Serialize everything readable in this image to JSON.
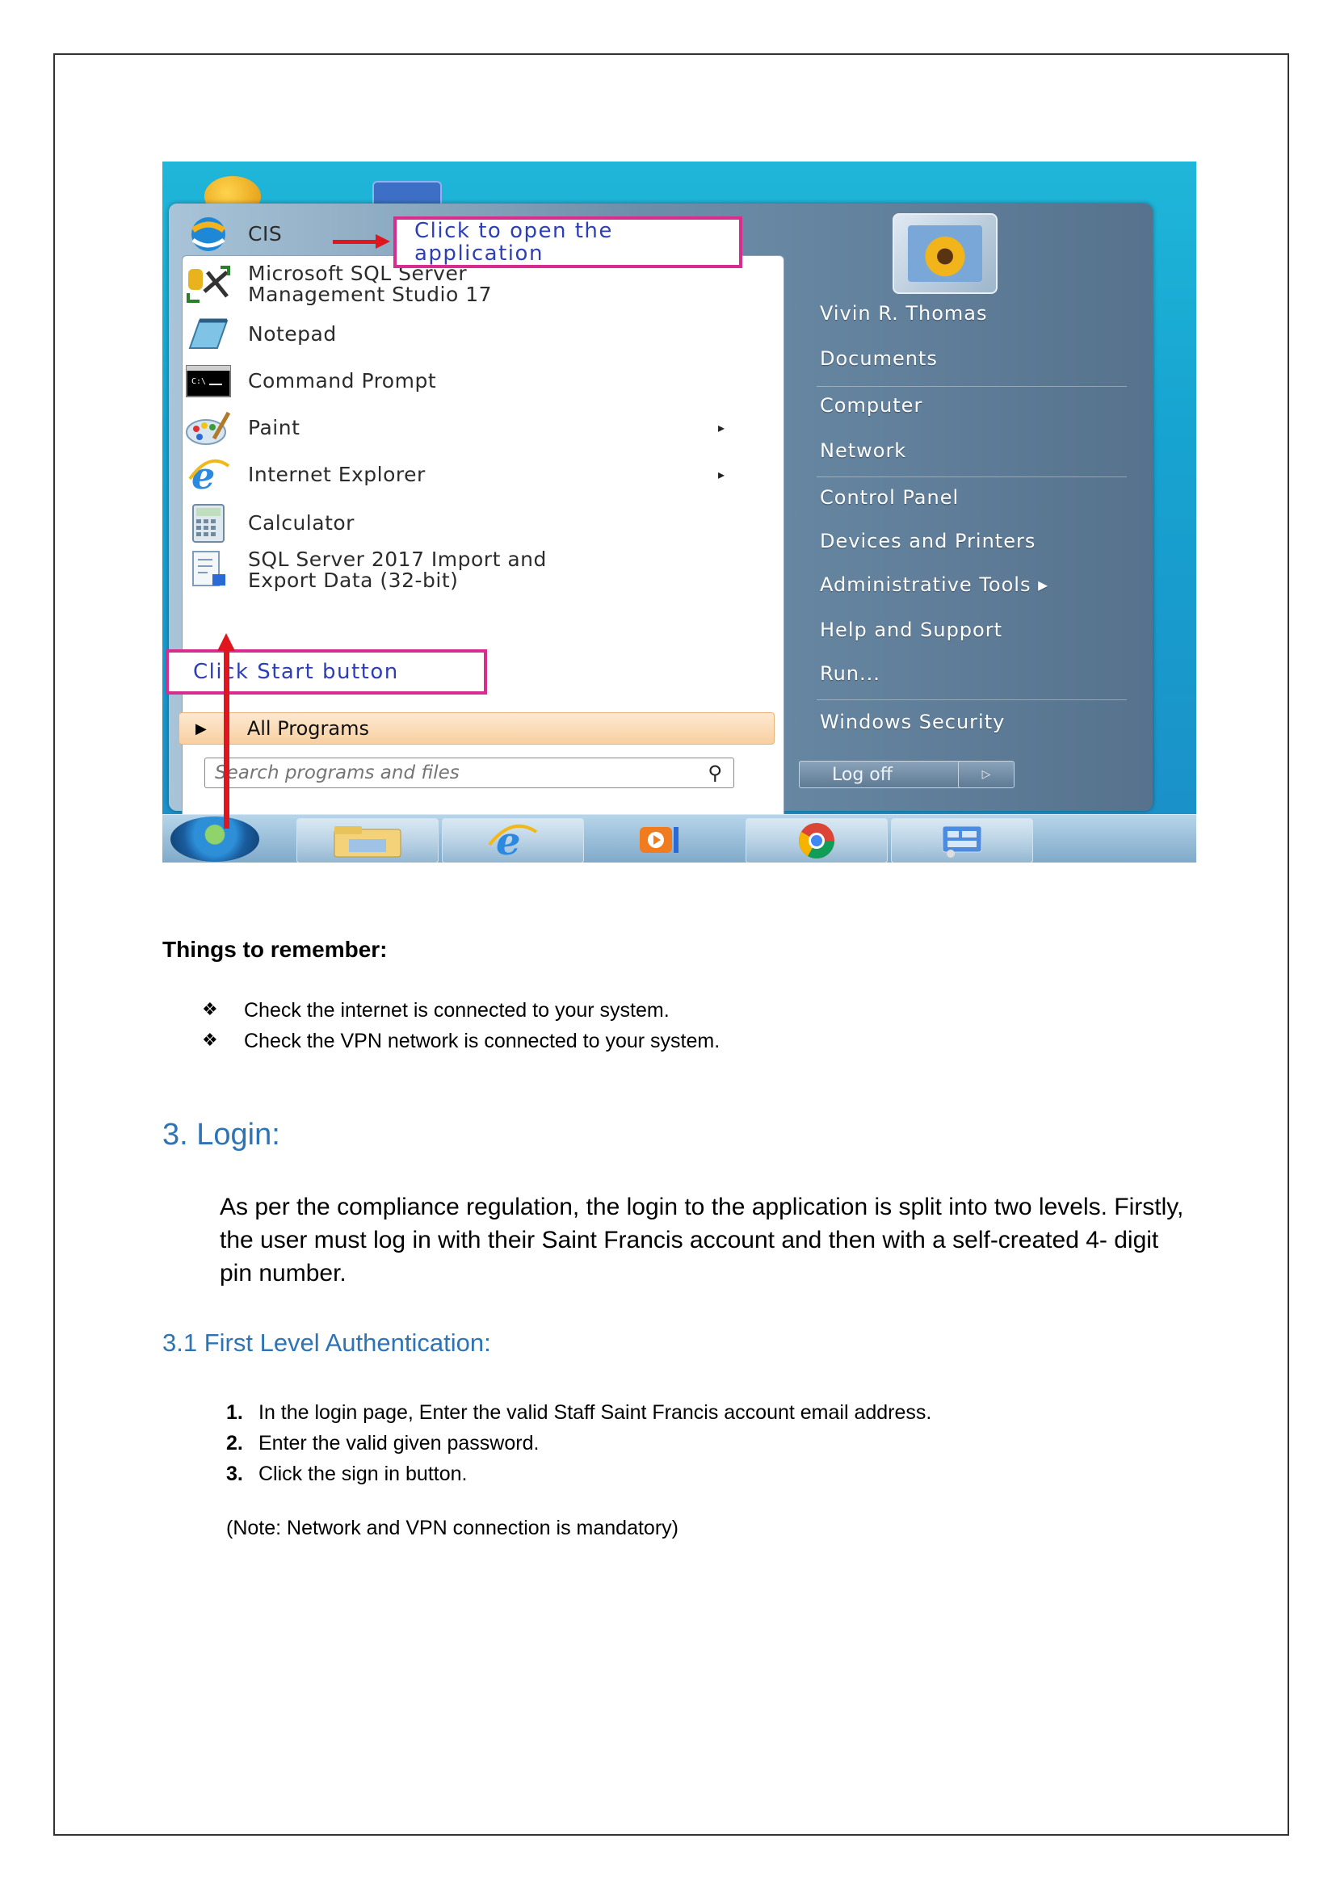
{
  "screenshot": {
    "callout_open": "Click to open the\napplication",
    "callout_start": "Click Start button",
    "programs": [
      {
        "label": "CIS",
        "icon": "cis-app-icon"
      },
      {
        "label": "Microsoft SQL Server\nManagement Studio 17",
        "icon": "sql-management-studio-icon"
      },
      {
        "label": "Notepad",
        "icon": "notepad-icon"
      },
      {
        "label": "Command Prompt",
        "icon": "command-prompt-icon"
      },
      {
        "label": "Paint",
        "icon": "paint-icon",
        "submenu": "▸"
      },
      {
        "label": "Internet Explorer",
        "icon": "internet-explorer-icon",
        "submenu": "▸"
      },
      {
        "label": "Calculator",
        "icon": "calculator-icon"
      },
      {
        "label": "SQL Server 2017 Import and\nExport Data (32-bit)",
        "icon": "sql-import-export-icon"
      }
    ],
    "all_programs": "All Programs",
    "all_programs_arrow": "▶",
    "search_placeholder": "Search programs and files",
    "right_items": [
      "Vivin R. Thomas",
      "Documents",
      "Computer",
      "Network",
      "Control Panel",
      "Devices and Printers",
      "Administrative Tools  ▸",
      "Help and Support",
      "Run...",
      "Windows Security"
    ],
    "log_off": "Log off",
    "log_off_arrow": "▷",
    "taskbar_icons": [
      "start-orb-icon",
      "file-explorer-icon",
      "internet-explorer-icon",
      "media-player-icon",
      "chrome-icon",
      "control-panel-icon"
    ]
  },
  "things": {
    "heading": "Things to remember:",
    "bullet_glyph": "❖",
    "items": [
      "Check the internet is connected to your system.",
      "Check the VPN network is connected to your system."
    ]
  },
  "login": {
    "heading": "3.  Login:",
    "paragraph": "As per the compliance regulation, the login to the application is split into two levels. Firstly, the user must log in with their Saint Francis account and then with a self-created 4- digit pin number."
  },
  "first_level": {
    "heading": "3.1 First Level Authentication:",
    "steps": [
      {
        "num": "1.",
        "text": "In the login page, Enter the valid Staff Saint Francis account email address."
      },
      {
        "num": "2.",
        "text": "Enter the valid given password."
      },
      {
        "num": "3.",
        "text": "Click the sign in button."
      }
    ],
    "note": "(Note: Network and VPN connection is mandatory)"
  }
}
